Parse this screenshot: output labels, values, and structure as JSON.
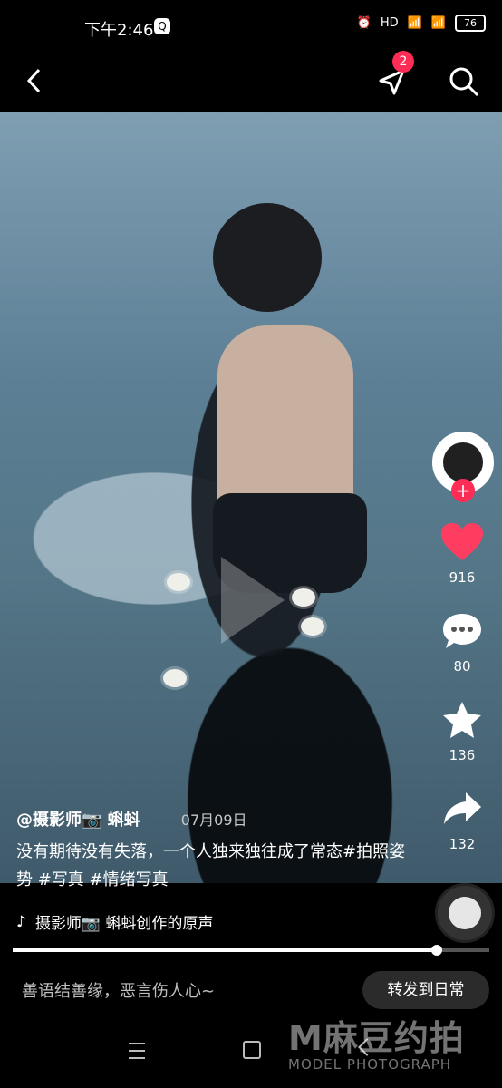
{
  "status_bar": {
    "time": "下午2:46",
    "network": "HD",
    "battery": "76"
  },
  "header": {
    "notification_count": "2"
  },
  "sidebar_actions": {
    "likes": "916",
    "comments": "80",
    "favorites": "136",
    "shares": "132"
  },
  "caption": {
    "author": "@摄影师📷 蝌蚪",
    "date": "07月09日",
    "text": "没有期待没有失落，一个人独来独往成了常态#拍照姿势 #写真 #情绪写真"
  },
  "music": {
    "title": "摄影师📷 蝌蚪创作的原声"
  },
  "progress": {
    "fraction": 0.89
  },
  "bottom": {
    "comment_placeholder": "善语结善缘，恶言伤人心~",
    "forward_label": "转发到日常"
  },
  "watermark": {
    "title": "M麻豆约拍",
    "subtitle": "MODEL PHOTOGRAPH"
  },
  "colors": {
    "accent": "#ff2c55",
    "background": "#000000"
  },
  "icons": {
    "back": "back-icon",
    "send": "send-icon",
    "search": "search-icon",
    "like": "heart-icon",
    "comment": "comment-icon",
    "favorite": "star-icon",
    "share": "share-icon",
    "music": "tiktok-icon"
  }
}
